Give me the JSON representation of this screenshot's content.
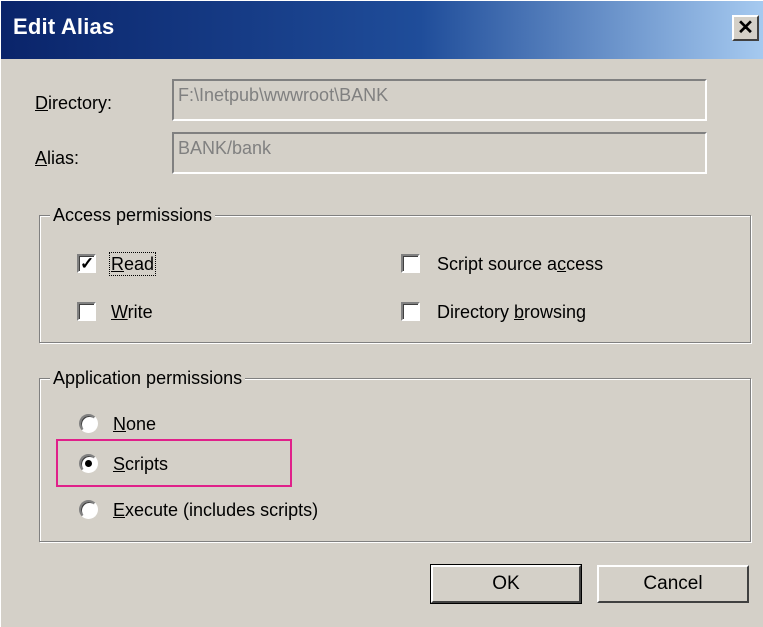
{
  "window": {
    "title": "Edit Alias",
    "close_glyph": "✕"
  },
  "fields": {
    "directory": {
      "label_u": "D",
      "label_rest": "irectory:",
      "value": "F:\\Inetpub\\wwwroot\\BANK"
    },
    "alias": {
      "label_u": "A",
      "label_rest": "lias:",
      "value": "BANK/bank"
    }
  },
  "access": {
    "title": "Access permissions",
    "read": {
      "label_u": "R",
      "label_rest": "ead",
      "checked": true
    },
    "write": {
      "label_u": "W",
      "label_rest": "rite",
      "checked": false
    },
    "script_source": {
      "label_pre": "Script source a",
      "label_u": "c",
      "label_rest": "cess",
      "checked": false
    },
    "dir_browsing": {
      "label_pre": "Directory ",
      "label_u": "b",
      "label_rest": "rowsing",
      "checked": false
    }
  },
  "application": {
    "title": "Application permissions",
    "none": {
      "label_u": "N",
      "label_rest": "one",
      "selected": false
    },
    "scripts": {
      "label_u": "S",
      "label_rest": "cripts",
      "selected": true
    },
    "execute": {
      "label_u": "E",
      "label_rest": "xecute (includes scripts)",
      "selected": false
    }
  },
  "buttons": {
    "ok": "OK",
    "cancel": "Cancel"
  },
  "colors": {
    "face": "#d4d0c8",
    "title_start": "#0a246a",
    "title_end": "#a6caf0",
    "highlight": "#e0208a"
  },
  "icons": {
    "check": "checkmark-icon",
    "close": "close-icon"
  }
}
